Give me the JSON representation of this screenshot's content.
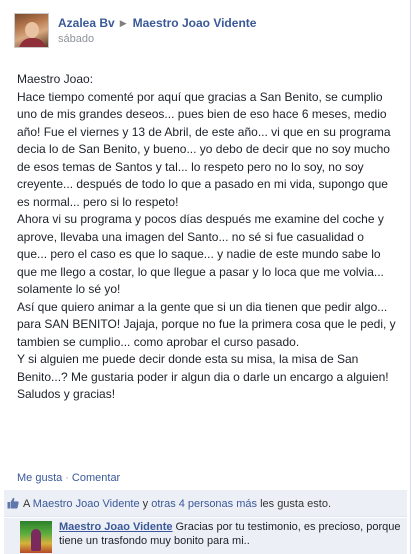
{
  "post": {
    "author": "Azalea Bv",
    "target": "Maestro Joao Vidente",
    "timestamp": "sábado",
    "message_lines": [
      "Maestro Joao:",
      "Hace tiempo comenté por aquí que gracias a San Benito, se cumplio uno de mis grandes deseos... pues bien de eso hace 6 meses, medio año! Fue el viernes y 13 de Abril, de este año... vi que en su programa decia lo de San Benito, y bueno... yo debo de decir que no soy mucho de esos temas de Santos y tal... lo respeto pero no lo soy, no soy creyente... después de todo lo que a pasado en mi vida, supongo que es normal... pero si lo respeto!",
      "Ahora vi su programa y pocos días después me examine del coche y aprove, llevaba una imagen del Santo... no sé si fue casualidad o que... pero el caso es que lo saque... y nadie de este mundo sabe lo que me llego a costar, lo que llegue a pasar y lo loca que me volvia... solamente lo sé yo!",
      "Así que quiero animar a la gente que si un dia tienen que pedir algo... para SAN BENITO! Jajaja, porque no fue la primera cosa que le pedi, y tambien se cumplio... como aprobar el curso pasado.",
      "Y si alguien me puede decir donde esta su misa, la misa de San Benito...? Me gustaria poder ir algun dia o darle un encargo a alguien!",
      "Saludos y gracias!"
    ]
  },
  "actions": {
    "like": "Me gusta",
    "separator": "·",
    "comment": "Comentar"
  },
  "likes": {
    "prefix": "A ",
    "page": "Maestro Joao Vidente",
    "middle": " y ",
    "others": "otras 4 personas más",
    "suffix": " les gusta esto."
  },
  "comment": {
    "author": "Maestro Joao Vidente",
    "text": "Gracias por tu testimonio, es precioso, porque tiene un trasfondo muy bonito para mi.."
  },
  "icons": {
    "breadcrumb": "triangle-right-icon",
    "like": "thumbs-up-icon"
  },
  "colors": {
    "link": "#3b5998",
    "bar_bg": "#eceff5",
    "meta": "#90949c"
  }
}
